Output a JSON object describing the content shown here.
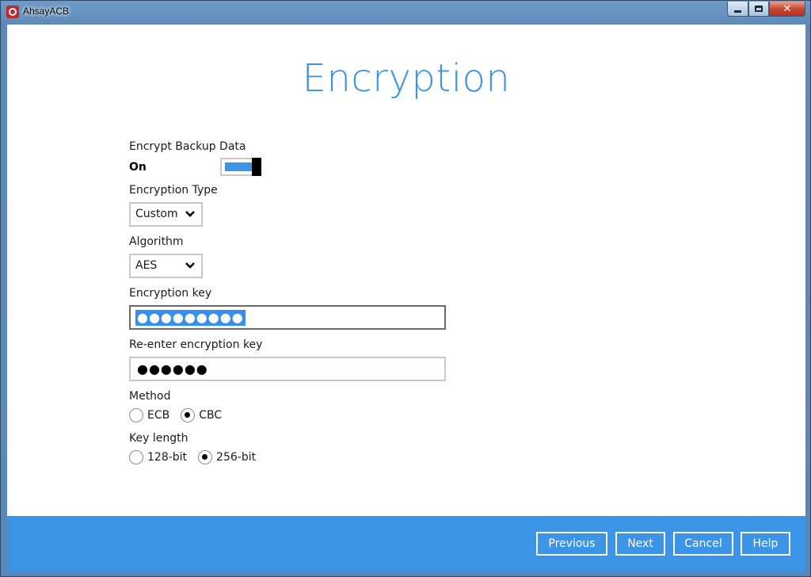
{
  "window": {
    "title": "AhsayACB"
  },
  "page": {
    "heading": "Encryption"
  },
  "encrypt_backup": {
    "label": "Encrypt Backup Data",
    "state_text": "On",
    "enabled": true
  },
  "encryption_type": {
    "label": "Encryption Type",
    "selected": "Custom"
  },
  "algorithm": {
    "label": "Algorithm",
    "selected": "AES"
  },
  "encryption_key": {
    "label": "Encryption key",
    "masked_value": "●●●●●●●●●"
  },
  "reenter_key": {
    "label": "Re-enter encryption key",
    "masked_value": "●●●●●●"
  },
  "method": {
    "label": "Method",
    "options": [
      "ECB",
      "CBC"
    ],
    "selected": "CBC"
  },
  "key_length": {
    "label": "Key length",
    "options": [
      "128-bit",
      "256-bit"
    ],
    "selected": "256-bit"
  },
  "footer": {
    "previous_label": "Previous",
    "next_label": "Next",
    "cancel_label": "Cancel",
    "help_label": "Help"
  },
  "colors": {
    "accent": "#3c94e6",
    "selection": "#3390f0"
  }
}
